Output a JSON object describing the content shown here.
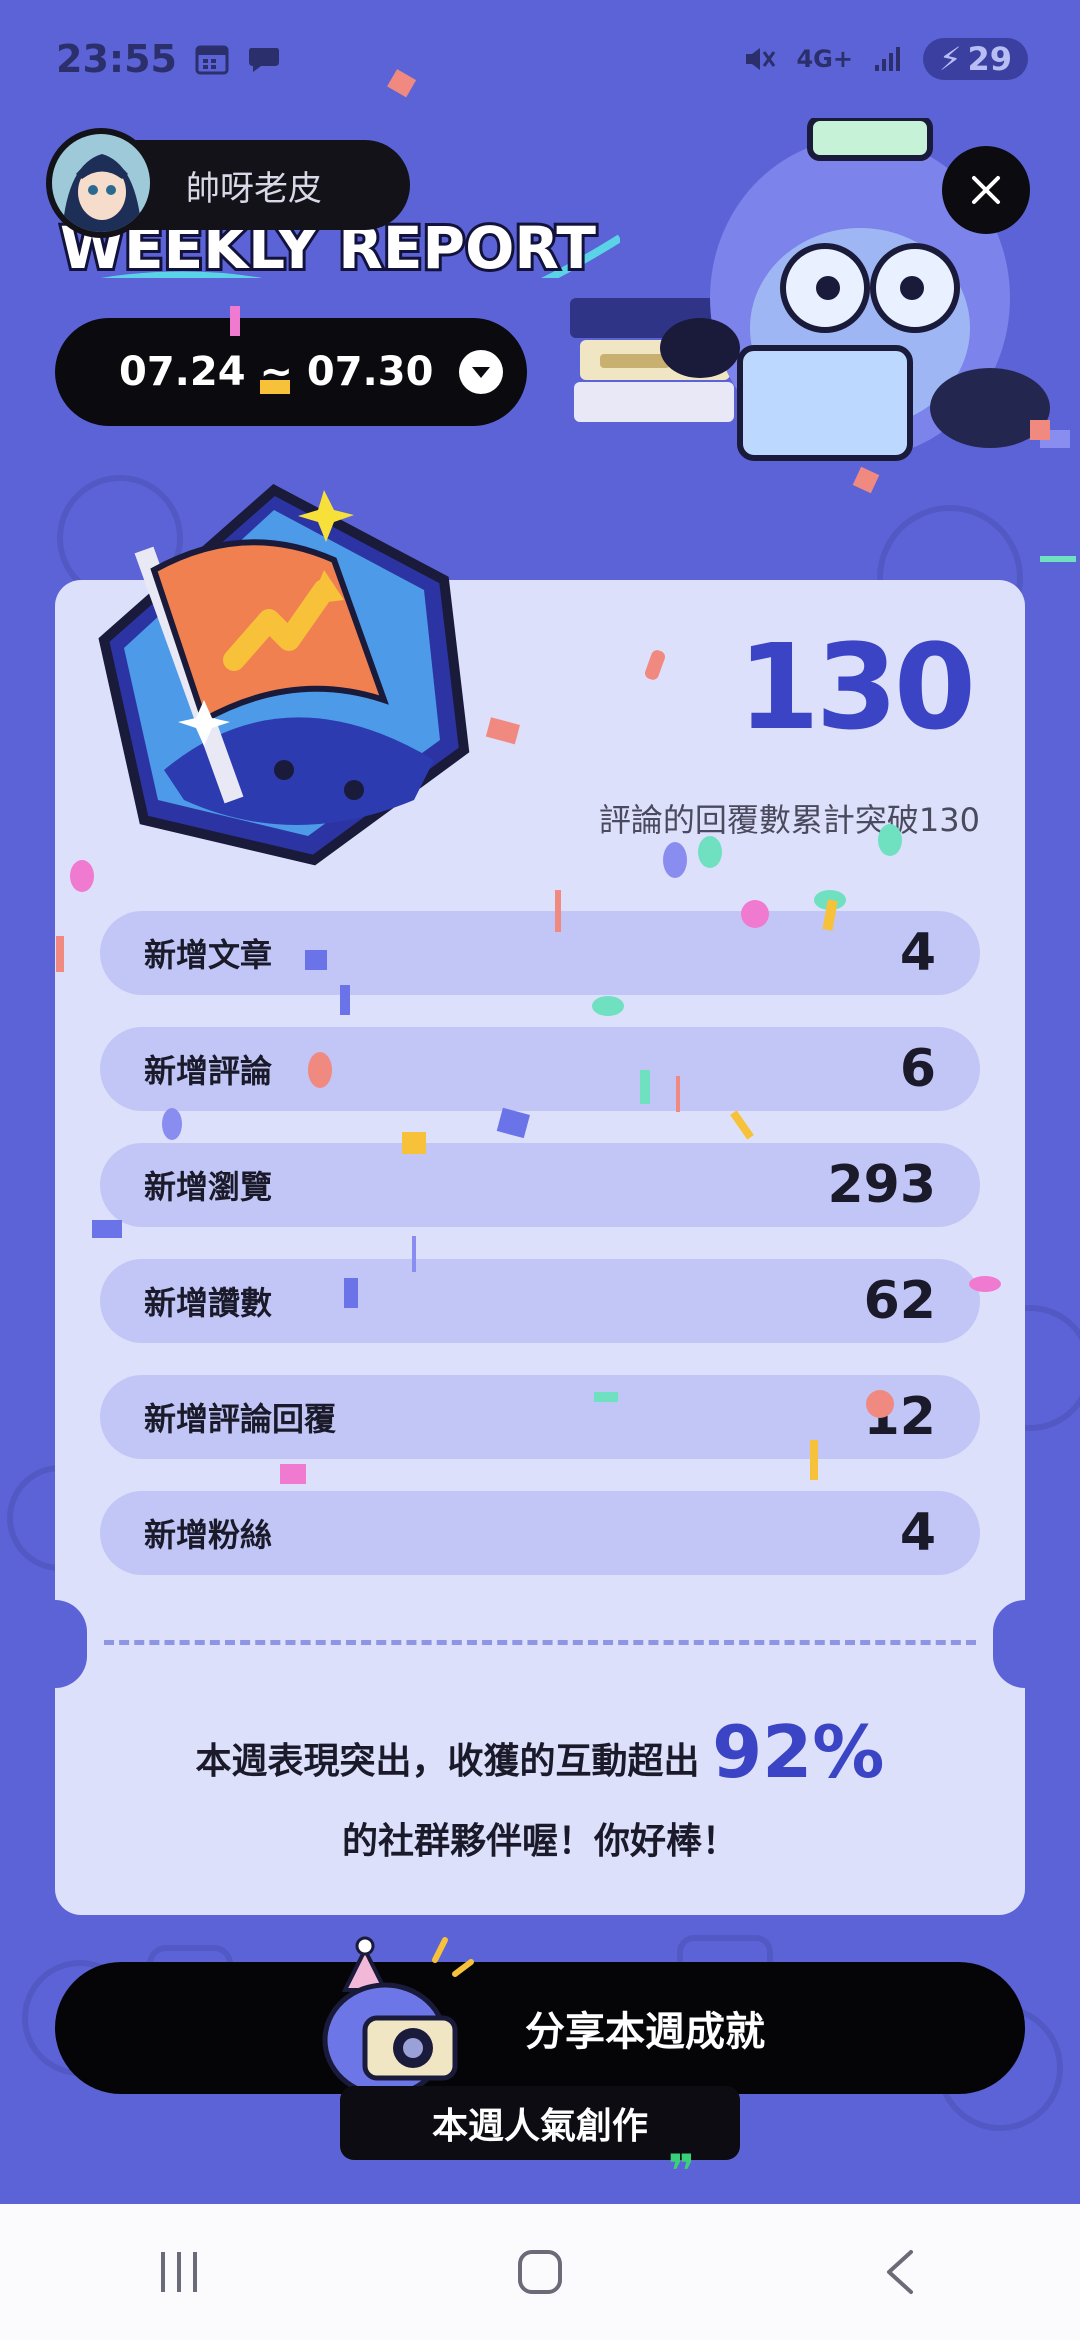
{
  "status_bar": {
    "time": "23:55",
    "network": "4G+",
    "battery": "29"
  },
  "header": {
    "avatar_name": "帥呀老皮",
    "banner_text": "WEEKLY REPORT",
    "date_range": "07.24 ~ 07.30"
  },
  "highlight": {
    "number": "130",
    "description": "評論的回覆數累計突破130"
  },
  "stats": [
    {
      "label": "新增文章",
      "value": "4"
    },
    {
      "label": "新增評論",
      "value": "6"
    },
    {
      "label": "新增瀏覽",
      "value": "293"
    },
    {
      "label": "新增讚數",
      "value": "62"
    },
    {
      "label": "新增評論回覆",
      "value": "12"
    },
    {
      "label": "新增粉絲",
      "value": "4"
    }
  ],
  "praise": {
    "line1_prefix": "本週表現突出，收獲的互動超出",
    "percent": "92%",
    "line2": "的社群夥伴喔！你好棒！"
  },
  "actions": {
    "share_label": "分享本週成就",
    "popular_label": "本週人氣創作"
  },
  "colors": {
    "background": "#5b63d6",
    "card": "#dde0fb",
    "row": "#c1c6f6",
    "accent": "#3a44c4",
    "button": "#050508"
  }
}
